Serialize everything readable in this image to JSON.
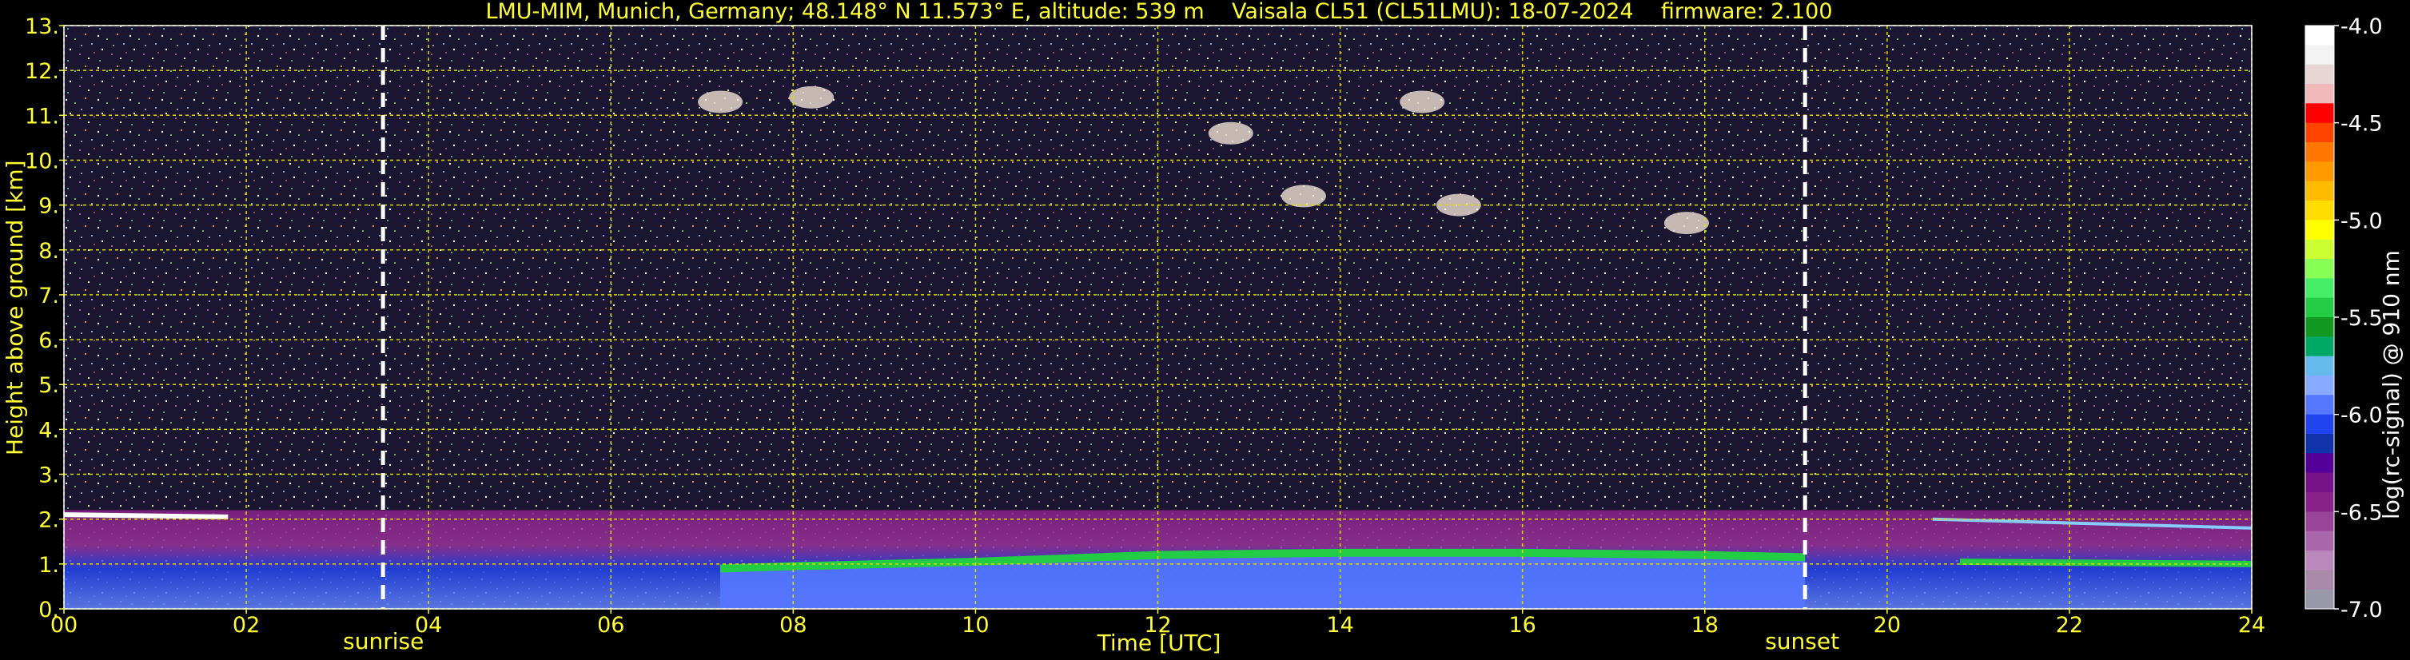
{
  "chart_data": {
    "type": "heatmap",
    "title": "LMU-MIM, Munich, Germany; 48.148° N 11.573° E, altitude: 539 m    Vaisala CL51 (CL51LMU): 18-07-2024    firmware: 2.100",
    "xlabel": "Time [UTC]",
    "ylabel": "Height above ground [km]",
    "colorbar_label": "log(rc-signal) @ 910 nm",
    "xlim": [
      0,
      24
    ],
    "ylim": [
      0,
      13
    ],
    "x_ticks": [
      "00",
      "02",
      "04",
      "06",
      "08",
      "10",
      "12",
      "14",
      "16",
      "18",
      "20",
      "22",
      "24"
    ],
    "y_ticks": [
      "0.",
      "1.",
      "2.",
      "3.",
      "4.",
      "5.",
      "6.",
      "7.",
      "8.",
      "9.",
      "10.",
      "11.",
      "12.",
      "13."
    ],
    "colorbar_range": [
      -7.0,
      -4.0
    ],
    "colorbar_ticks": [
      "-4.0",
      "-4.5",
      "-5.0",
      "-5.5",
      "-6.0",
      "-6.5",
      "-7.0"
    ],
    "grid": true,
    "events": [
      {
        "label": "sunrise",
        "time": 3.5
      },
      {
        "label": "sunset",
        "time": 19.1
      }
    ],
    "colorbar_colors": [
      "#ffffff",
      "#f3f3f3",
      "#e8d5d5",
      "#f0b8b8",
      "#ff0000",
      "#ff4400",
      "#ff7700",
      "#ff9900",
      "#ffbb00",
      "#ffdd00",
      "#ffff00",
      "#ccff33",
      "#88ff55",
      "#44ee66",
      "#22cc44",
      "#119922",
      "#00aa66",
      "#66bbee",
      "#88aaff",
      "#5577ff",
      "#2244ee",
      "#1133aa",
      "#550099",
      "#771188",
      "#882288",
      "#994499",
      "#aa66aa",
      "#bb88bb",
      "#aa88aa",
      "#9999aa"
    ]
  }
}
